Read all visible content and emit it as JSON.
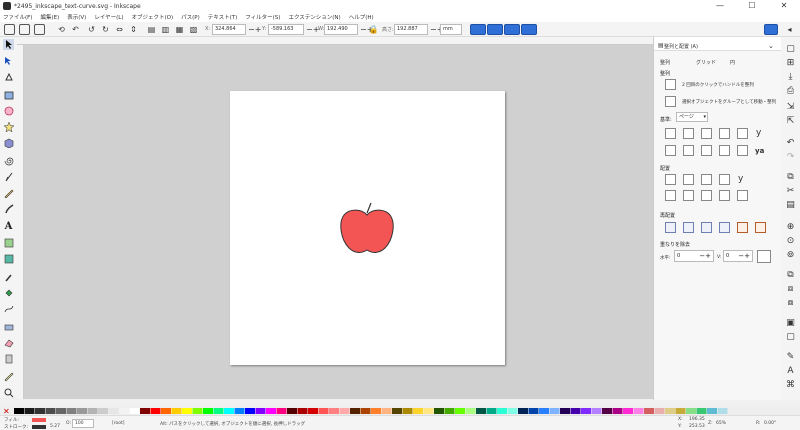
{
  "window": {
    "title": "*2495_inkscape_text-curve.svg - Inkscape",
    "minimize": "—",
    "maximize": "☐",
    "close": "✕"
  },
  "menus": [
    "ファイル(F)",
    "編集(E)",
    "表示(V)",
    "レイヤー(L)",
    "オブジェクト(O)",
    "パス(P)",
    "テキスト(T)",
    "フィルター(S)",
    "エクステンション(N)",
    "ヘルプ(H)"
  ],
  "toolbar": {
    "x_label": "X:",
    "x_value": "324.864",
    "y_label": "Y:",
    "y_value": "-589.163",
    "w_label": "W:",
    "w_value": "192.490",
    "h_label": "高さ:",
    "h_value": "192.887",
    "unit": "mm"
  },
  "dock": {
    "tab_title": "整列と配置 (A)",
    "subtabs": [
      "整列",
      "グリッド",
      "円"
    ],
    "section_align": "整列",
    "option_click": "2 回目のクリックでハンドルを整列",
    "option_group": "選択オブジェクトをグループとして移動・整列",
    "relative_label": "基準:",
    "relative_value": "ページ",
    "section_distribute": "配置",
    "section_rearrange": "再配置",
    "section_overlap": "重なりを除去",
    "gap_h_label": "水平:",
    "gap_h_value": "0",
    "gap_v_label": "V:",
    "gap_v_value": "0"
  },
  "colors": {
    "apple_fill": "#f35555",
    "apple_stroke": "#333333",
    "accent": "#2f6fd6"
  },
  "status": {
    "fill_label": "フィル:",
    "stroke_label": "ストローク:",
    "fill_value": "",
    "stroke_value": "5.27",
    "opacity_label": "O:",
    "opacity_value": "100",
    "layer": "[root]",
    "message": "Alt: パスをクリックして選択, オブジェクトを順に選択, 長押しドラッグ",
    "x_coord": "196.35",
    "y_coord": "253.53",
    "zoom_label": "Z:",
    "zoom_value": "65%",
    "rotate_label": "R:",
    "rotate_value": "0.00°"
  }
}
